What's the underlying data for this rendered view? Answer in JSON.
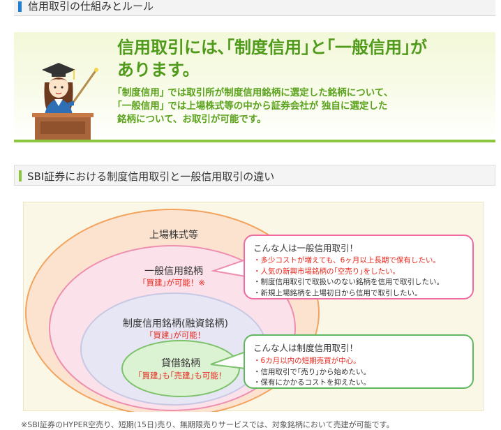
{
  "top_header": {
    "title": "信用取引の仕組みとルール"
  },
  "banner": {
    "headline_line1": "信用取引には､｢制度信用｣と｢一般信用｣が",
    "headline_line2": "あります。",
    "sub_line1": "｢制度信用｣ では取引所が制度信用銘柄に選定した銘柄について､",
    "sub_line2": "｢一般信用｣ では上場株式等の中から証券会社が 独自に選定した",
    "sub_line3": "銘柄について、お取引が可能です。"
  },
  "section": {
    "title": "SBI証券における制度信用取引と一般信用取引の違い"
  },
  "diagram": {
    "listed": "上場株式等",
    "general": {
      "name": "一般信用銘柄",
      "note": "｢買建｣が可能！※"
    },
    "system": {
      "name": "制度信用銘柄(融資銘柄)",
      "note": "｢買建｣が可能！"
    },
    "lending": {
      "name": "貸借銘柄",
      "note": "｢買建｣も｢売建｣も可能！"
    },
    "colors": {
      "listed_fill": "#fbe3cf",
      "listed_stroke": "#f2a35e",
      "general_fill": "#fbe1e9",
      "general_stroke": "#ee8eb0",
      "system_fill": "#e6e6f4",
      "system_stroke": "#c8c8e4",
      "lending_fill": "#dcf3d3",
      "lending_stroke": "#7cc26a"
    }
  },
  "callout_general": {
    "title": "こんな人は一般信用取引！",
    "items": [
      {
        "text": "・多少コストが増えても、6ヶ月以上長期で保有したい。",
        "red": true
      },
      {
        "text": "・人気の新興市場銘柄の｢空売り｣をしたい。",
        "red": true
      },
      {
        "text": "・制度信用取引で取扱いのない銘柄を信用で取引したい。",
        "red": false
      },
      {
        "text": "・新規上場銘柄を上場初日から信用で取引したい。",
        "red": false
      }
    ]
  },
  "callout_system": {
    "title": "こんな人は制度信用取引！",
    "items": [
      {
        "text": "・6カ月以内の短期売買が中心。",
        "red": true
      },
      {
        "text": "・信用取引で｢売り｣から始めたい。",
        "red": false
      },
      {
        "text": "・保有にかかるコストを抑えたい。",
        "red": false
      }
    ]
  },
  "footnote": "※SBI証券のHYPER空売り、短期(15日)売り、無期限売りサービスでは、対象銘柄において売建が可能です。"
}
